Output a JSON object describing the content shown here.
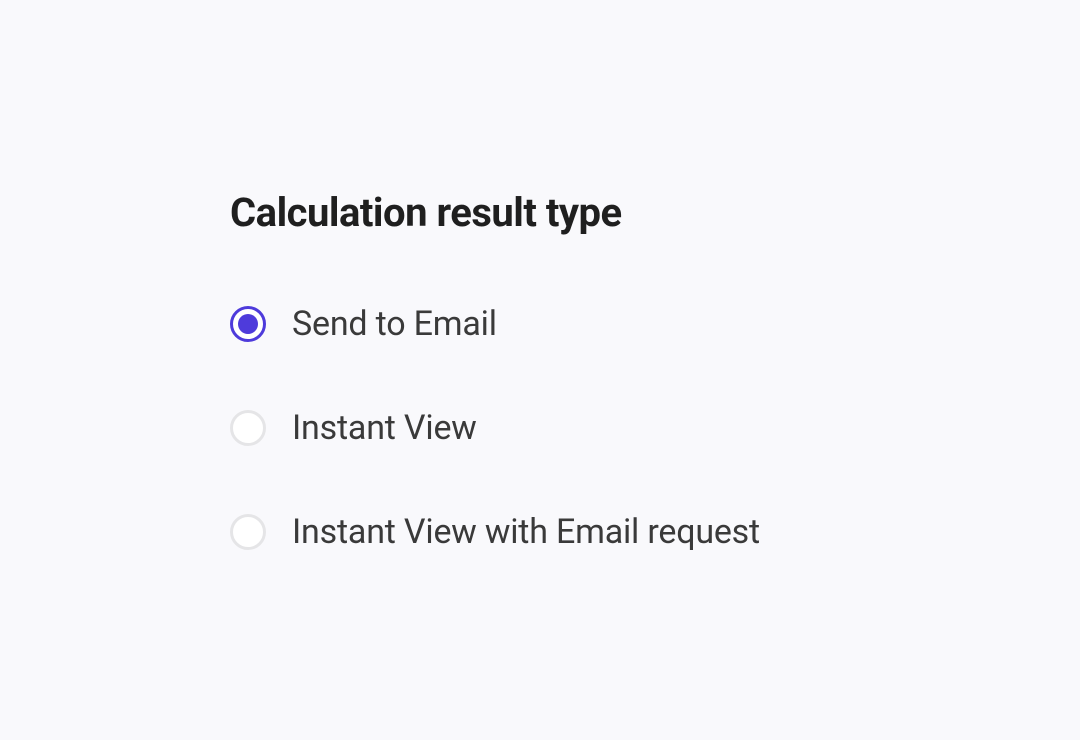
{
  "heading": "Calculation result type",
  "options": [
    {
      "label": "Send to Email",
      "selected": true
    },
    {
      "label": "Instant View",
      "selected": false
    },
    {
      "label": "Instant View with Email request",
      "selected": false
    }
  ]
}
